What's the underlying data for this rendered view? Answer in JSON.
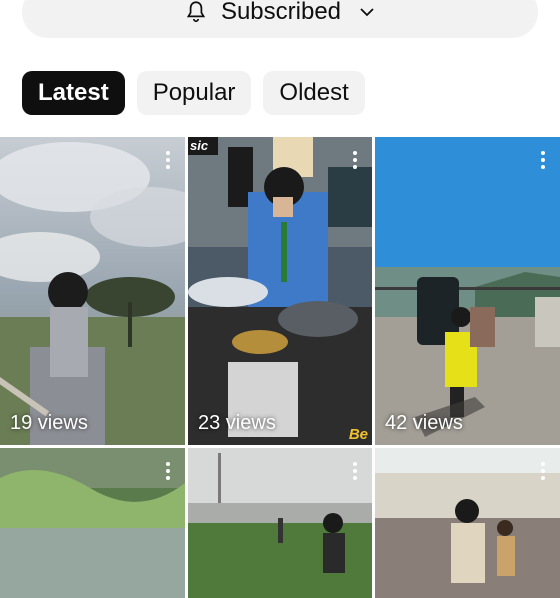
{
  "subscription": {
    "label": "Subscribed"
  },
  "filters": [
    {
      "label": "Latest",
      "active": true
    },
    {
      "label": "Popular",
      "active": false
    },
    {
      "label": "Oldest",
      "active": false
    }
  ],
  "videos": [
    {
      "views": "19 views"
    },
    {
      "views": "23 views",
      "overlay_text": [
        "sic",
        "Be"
      ]
    },
    {
      "views": "42 views"
    },
    {
      "views": ""
    },
    {
      "views": ""
    },
    {
      "views": ""
    }
  ]
}
